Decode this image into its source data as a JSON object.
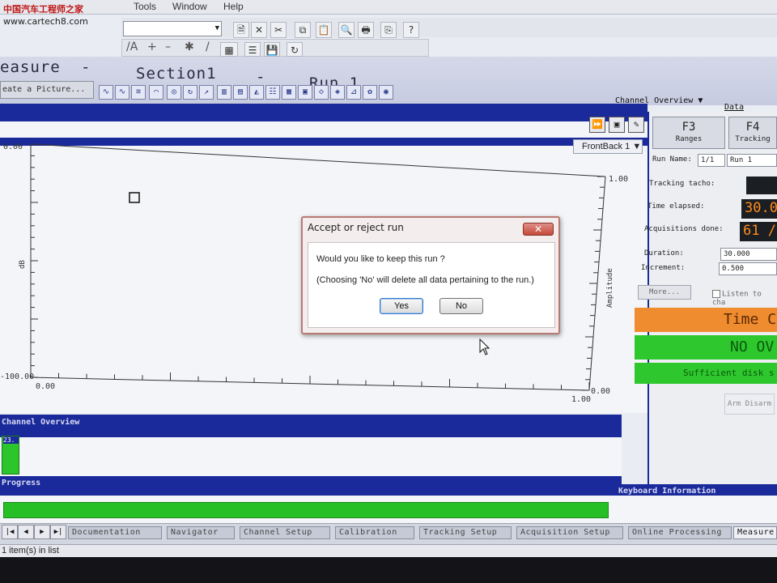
{
  "watermark": {
    "text": "中国汽车工程师之家",
    "url": "www.cartech8.com"
  },
  "menu": {
    "items": [
      "Tools",
      "Window",
      "Help"
    ]
  },
  "title": {
    "measure": "easure",
    "sep1": "-",
    "section": "Section1",
    "sep2": "-",
    "run": "Run 1"
  },
  "create_picture": "eate a Picture...",
  "channel_overview_dropdown": "Channel Overview",
  "data_explorer_link": "Data Explor",
  "plot": {
    "frontback_label": "FrontBack 1",
    "left_axis_label": "dB",
    "right_axis_label": "Amplitude",
    "y_top": "0.00",
    "y_bottom": "-100.00",
    "x_left": "0.00",
    "x_right": "1.00",
    "right_top": "1.00",
    "right_bottom": "0.00"
  },
  "dialog": {
    "title": "Accept or reject run",
    "question": "Would you like to keep this run ?",
    "note": "(Choosing 'No' will delete all data pertaining to the run.)",
    "yes": "Yes",
    "no": "No",
    "close": "✕"
  },
  "right_panel": {
    "f3_key": "F3",
    "f3_name": "Ranges",
    "f4_key": "F4",
    "f4_name": "Tracking",
    "run_name_label": "Run Name:",
    "run_name_index": "1/1",
    "run_name_value": "Run 1",
    "tracking_tacho_label": "Tracking tacho:",
    "time_elapsed_label": "Time elapsed:",
    "time_elapsed_value": "30.0",
    "acquisitions_label": "Acquisitions done:",
    "acquisitions_value": "61 /",
    "duration_label": "Duration:",
    "duration_value": "30.000",
    "increment_label": "Increment:",
    "increment_value": "0.500",
    "more_button": "More...",
    "listen_label": "Listen to cha",
    "status_time": "Time C",
    "status_overload": "NO OV",
    "status_disk": "Sufficient disk s",
    "arm_disarm": "Arm Disarm"
  },
  "channel_overview": {
    "title": "Channel Overview",
    "channel_label": "23."
  },
  "progress": {
    "title": "Progress",
    "percent": 100
  },
  "keyboard_info": {
    "title": "Keyboard Information"
  },
  "tabs": [
    {
      "label": "Documentation"
    },
    {
      "label": "Navigator"
    },
    {
      "label": "Channel Setup"
    },
    {
      "label": "Calibration"
    },
    {
      "label": "Tracking Setup"
    },
    {
      "label": "Acquisition Setup"
    },
    {
      "label": "Online Processing"
    },
    {
      "label": "Measure"
    }
  ],
  "status_bar": "1 item(s) in list",
  "colors": {
    "accent_blue": "#1b2a9a",
    "status_green": "#2ec82e",
    "status_orange": "#f08c30"
  }
}
